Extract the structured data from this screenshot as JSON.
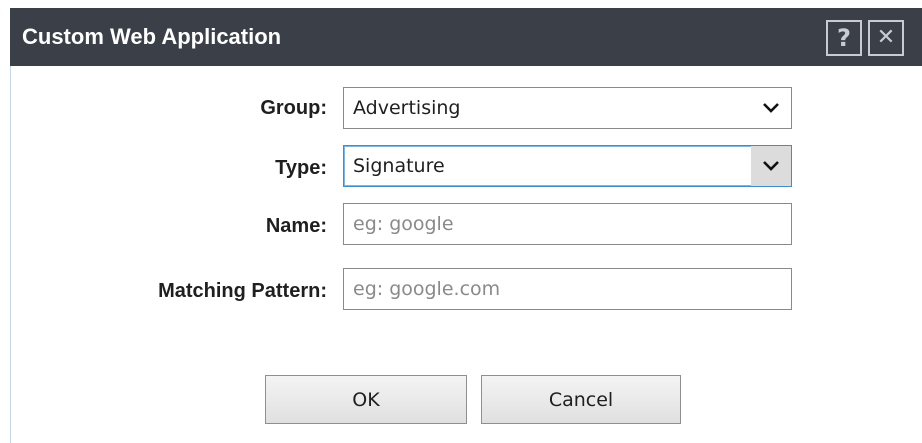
{
  "dialog": {
    "title": "Custom Web Application",
    "help_icon": "help-icon",
    "help_glyph": "?",
    "close_icon": "close-icon",
    "close_glyph": "✕"
  },
  "form": {
    "group": {
      "label": "Group:",
      "value": "Advertising"
    },
    "type": {
      "label": "Type:",
      "value": "Signature"
    },
    "name": {
      "label": "Name:",
      "value": "",
      "placeholder": "eg: google"
    },
    "matching_pattern": {
      "label": "Matching Pattern:",
      "value": "",
      "placeholder": "eg: google.com"
    }
  },
  "buttons": {
    "ok_label": "OK",
    "cancel_label": "Cancel"
  },
  "colors": {
    "titlebar": "#3a3f48",
    "focus_border": "#3d8fd0",
    "placeholder": "#8a8a8a"
  }
}
